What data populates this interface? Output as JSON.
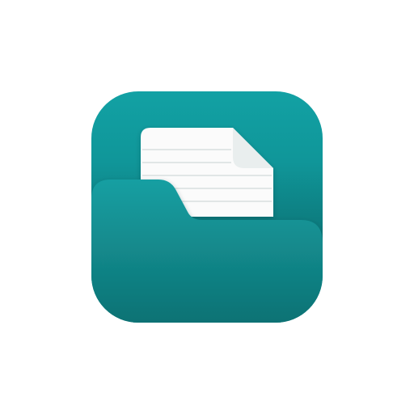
{
  "app_icon": {
    "icon": "folder-document-icon",
    "colors": {
      "tile_top": "#12A1A4",
      "tile_bottom": "#0B7D80",
      "folder_front_top": "#169FA2",
      "folder_front_bottom": "#0E7274",
      "folder_tab": "#14A0A2",
      "paper": "#FBFBFB",
      "paper_fold": "#E9EEEE",
      "paper_lines": "#E1E6E6",
      "background": "#FFFFFF"
    }
  }
}
